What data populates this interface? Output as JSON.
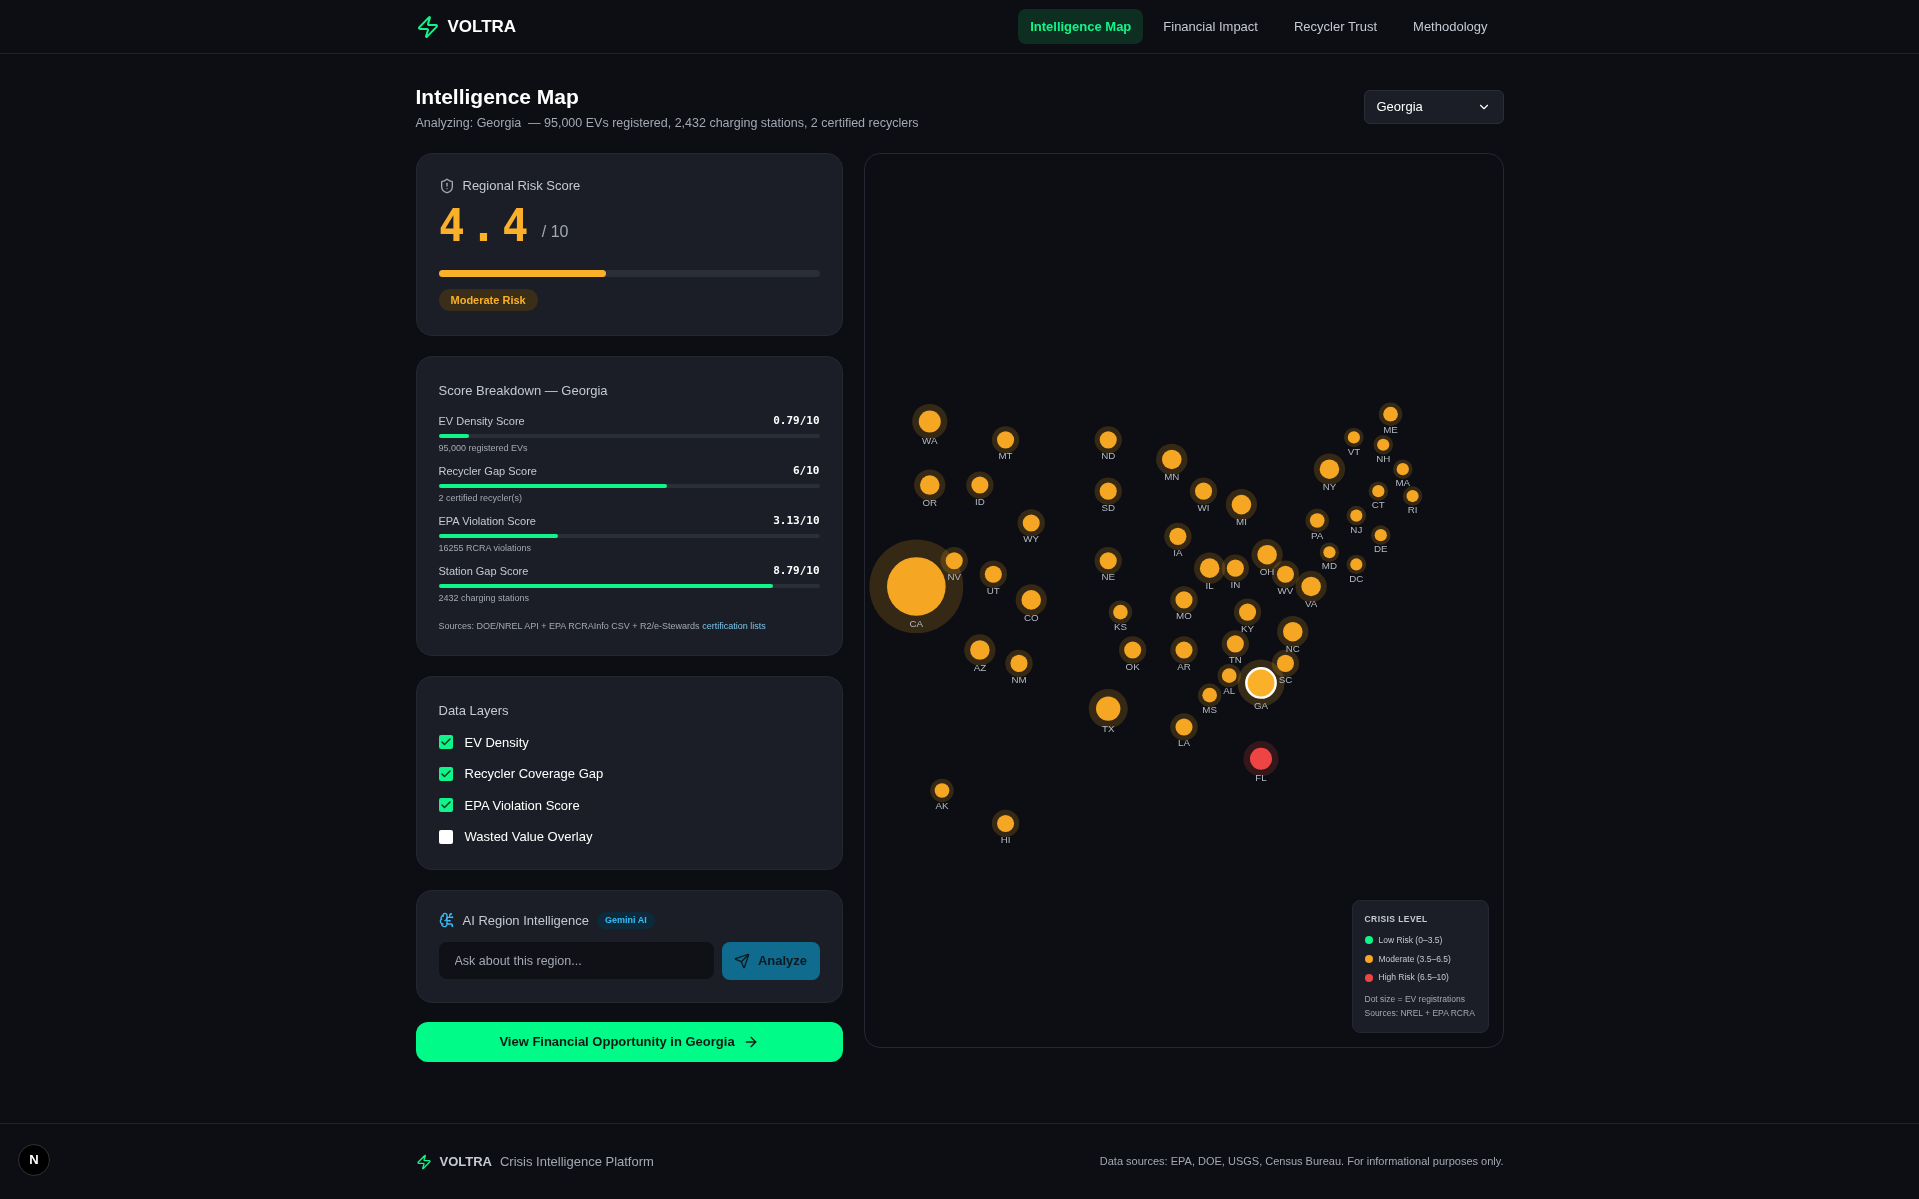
{
  "brand": {
    "name": "VOLTRA"
  },
  "nav": [
    {
      "label": "Intelligence Map",
      "selected": true
    },
    {
      "label": "Financial Impact",
      "selected": false
    },
    {
      "label": "Recycler Trust",
      "selected": false
    },
    {
      "label": "Methodology",
      "selected": false
    }
  ],
  "page": {
    "title": "Intelligence Map",
    "subtitle": "Analyzing: Georgia  — 95,000 EVs registered, 2,432 charging stations, 2 certified recyclers",
    "region_select": "Georgia"
  },
  "risk_card": {
    "title": "Regional Risk Score",
    "score": "4.4",
    "max": "/ 10",
    "level": 0.44,
    "badge": "Moderate Risk"
  },
  "breakdown": {
    "title": "Score Breakdown — Georgia",
    "items": [
      {
        "label": "EV Density Score",
        "value": "0.79/10",
        "level": 0.079,
        "note": "95,000 registered EVs"
      },
      {
        "label": "Recycler Gap Score",
        "value": "6/10",
        "level": 0.6,
        "note": "2 certified recycler(s)"
      },
      {
        "label": "EPA Violation Score",
        "value": "3.13/10",
        "level": 0.313,
        "note": "16255 RCRA violations"
      },
      {
        "label": "Station Gap Score",
        "value": "8.79/10",
        "level": 0.879,
        "note": "2432 charging stations"
      }
    ],
    "sources": "Sources: DOE/NREL API + EPA RCRAInfo CSV + R2/e-Stewards",
    "sources_link": "certification lists"
  },
  "layers": {
    "title": "Data Layers",
    "items": [
      {
        "label": "EV Density",
        "checked": true
      },
      {
        "label": "Recycler Coverage Gap",
        "checked": true
      },
      {
        "label": "EPA Violation Score",
        "checked": true
      },
      {
        "label": "Wasted Value Overlay",
        "checked": false
      }
    ]
  },
  "ai": {
    "title": "AI Region Intelligence",
    "badge": "Gemini AI",
    "placeholder": "Ask about this region...",
    "button": "Analyze"
  },
  "cta": "View Financial Opportunity in Georgia",
  "map": {
    "states": [
      {
        "label": "WA",
        "color": "#f5a623",
        "selected": false
      },
      {
        "label": "MT",
        "color": "#f5a623",
        "selected": false
      },
      {
        "label": "ND",
        "color": "#f5a623",
        "selected": false
      },
      {
        "label": "MN",
        "color": "#f5a623",
        "selected": false
      },
      {
        "label": "ME",
        "color": "#f5a623",
        "selected": false
      },
      {
        "label": "VT",
        "color": "#f5a623",
        "selected": false
      },
      {
        "label": "NH",
        "color": "#f5a623",
        "selected": false
      },
      {
        "label": "NY",
        "color": "#f5a623",
        "selected": false
      },
      {
        "label": "MA",
        "color": "#f5a623",
        "selected": false
      },
      {
        "label": "RI",
        "color": "#f5a623",
        "selected": false
      },
      {
        "label": "CT",
        "color": "#f5a623",
        "selected": false
      },
      {
        "label": "PA",
        "color": "#f5a623",
        "selected": false
      },
      {
        "label": "NJ",
        "color": "#f5a623",
        "selected": false
      },
      {
        "label": "DE",
        "color": "#f5a623",
        "selected": false
      },
      {
        "label": "MD",
        "color": "#f5a623",
        "selected": false
      },
      {
        "label": "DC",
        "color": "#f5a623",
        "selected": false
      },
      {
        "label": "OR",
        "color": "#f5a623",
        "selected": false
      },
      {
        "label": "ID",
        "color": "#f5a623",
        "selected": false
      },
      {
        "label": "SD",
        "color": "#f5a623",
        "selected": false
      },
      {
        "label": "WI",
        "color": "#f5a623",
        "selected": false
      },
      {
        "label": "MI",
        "color": "#f5a623",
        "selected": false
      },
      {
        "label": "WY",
        "color": "#f5a623",
        "selected": false
      },
      {
        "label": "IA",
        "color": "#f5a623",
        "selected": false
      },
      {
        "label": "NV",
        "color": "#f5a623",
        "selected": false
      },
      {
        "label": "UT",
        "color": "#f5a623",
        "selected": false
      },
      {
        "label": "NE",
        "color": "#f5a623",
        "selected": false
      },
      {
        "label": "IL",
        "color": "#f5a623",
        "selected": false
      },
      {
        "label": "IN",
        "color": "#f5a623",
        "selected": false
      },
      {
        "label": "OH",
        "color": "#f5a623",
        "selected": false
      },
      {
        "label": "WV",
        "color": "#f5a623",
        "selected": false
      },
      {
        "label": "VA",
        "color": "#f5a623",
        "selected": false
      },
      {
        "label": "CA",
        "color": "#f5a623",
        "selected": false
      },
      {
        "label": "CO",
        "color": "#f5a623",
        "selected": false
      },
      {
        "label": "KS",
        "color": "#f5a623",
        "selected": false
      },
      {
        "label": "MO",
        "color": "#f5a623",
        "selected": false
      },
      {
        "label": "KY",
        "color": "#f5a623",
        "selected": false
      },
      {
        "label": "NC",
        "color": "#f5a623",
        "selected": false
      },
      {
        "label": "AZ",
        "color": "#f5a623",
        "selected": false
      },
      {
        "label": "NM",
        "color": "#f5a623",
        "selected": false
      },
      {
        "label": "OK",
        "color": "#f5a623",
        "selected": false
      },
      {
        "label": "AR",
        "color": "#f5a623",
        "selected": false
      },
      {
        "label": "TN",
        "color": "#f5a623",
        "selected": false
      },
      {
        "label": "SC",
        "color": "#f5a623",
        "selected": false
      },
      {
        "label": "AL",
        "color": "#f5a623",
        "selected": false
      },
      {
        "label": "MS",
        "color": "#f5a623",
        "selected": false
      },
      {
        "label": "GA",
        "color": "#fbb02a",
        "selected": true
      },
      {
        "label": "TX",
        "color": "#f5a623",
        "selected": false
      },
      {
        "label": "LA",
        "color": "#f5a623",
        "selected": false
      },
      {
        "label": "FL",
        "color": "#ef4444",
        "selected": false
      },
      {
        "label": "AK",
        "color": "#f5a623",
        "selected": false
      },
      {
        "label": "HI",
        "color": "#f5a623",
        "selected": false
      }
    ],
    "legend": {
      "title": "CRISIS LEVEL",
      "items": [
        {
          "label": "Low Risk (0–3.5)",
          "color": "#10f58a"
        },
        {
          "label": "Moderate (3.5–6.5)",
          "color": "#f5a623"
        },
        {
          "label": "High Risk (6.5–10)",
          "color": "#ef4444"
        }
      ],
      "notes": [
        "Dot size = EV registrations",
        "Sources: NREL + EPA RCRA"
      ]
    }
  },
  "footer": {
    "brand": "VOLTRA",
    "tagline": "Crisis Intelligence Platform",
    "sources": "Data sources: EPA, DOE, USGS, Census Bureau. For informational purposes only."
  },
  "dev_badge": "N"
}
